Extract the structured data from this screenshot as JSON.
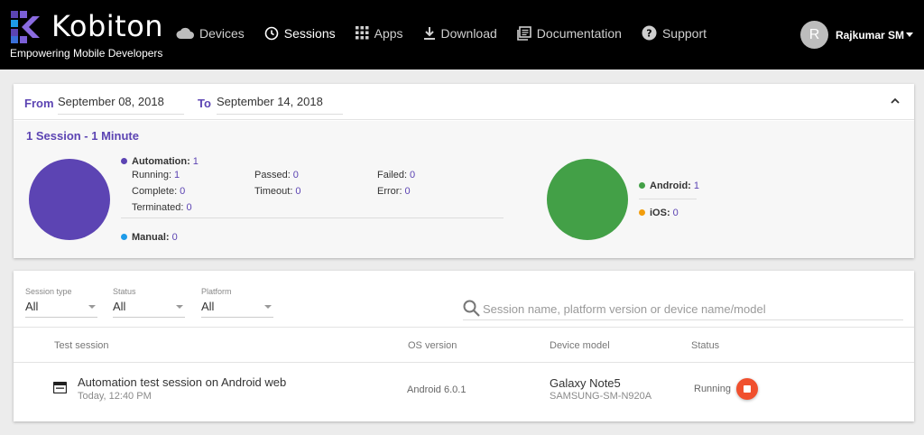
{
  "header": {
    "brand": "Kobiton",
    "tagline": "Empowering Mobile Developers",
    "nav": [
      {
        "label": "Devices",
        "icon": "cloud-icon"
      },
      {
        "label": "Sessions",
        "icon": "clock-icon",
        "active": true
      },
      {
        "label": "Apps",
        "icon": "grid-icon"
      },
      {
        "label": "Download",
        "icon": "download-icon"
      },
      {
        "label": "Documentation",
        "icon": "docs-icon"
      },
      {
        "label": "Support",
        "icon": "help-icon"
      }
    ],
    "user": {
      "initial": "R",
      "name": "Rajkumar SM"
    }
  },
  "summary": {
    "from_label": "From",
    "from_value": "September 08, 2018",
    "to_label": "To",
    "to_value": "September 14, 2018",
    "session_count": "1 Session - 1 Minute",
    "automation": {
      "label": "Automation:",
      "value": "1"
    },
    "stats": [
      {
        "label": "Running:",
        "value": "1"
      },
      {
        "label": "Passed:",
        "value": "0"
      },
      {
        "label": "Failed:",
        "value": "0"
      },
      {
        "label": "Complete:",
        "value": "0"
      },
      {
        "label": "Timeout:",
        "value": "0"
      },
      {
        "label": "Error:",
        "value": "0"
      },
      {
        "label": "Terminated:",
        "value": "0"
      }
    ],
    "manual": {
      "label": "Manual:",
      "value": "0"
    },
    "android": {
      "label": "Android:",
      "value": "1"
    },
    "ios": {
      "label": "iOS:",
      "value": "0"
    }
  },
  "filters": {
    "session_type": {
      "label": "Session type",
      "value": "All"
    },
    "status": {
      "label": "Status",
      "value": "All"
    },
    "platform": {
      "label": "Platform",
      "value": "All"
    },
    "search_placeholder": "Session name, platform version or device name/model"
  },
  "table": {
    "headers": [
      "Test session",
      "OS version",
      "Device model",
      "Status"
    ],
    "rows": [
      {
        "name": "Automation test session on Android web",
        "time": "Today, 12:40 PM",
        "os": "Android 6.0.1",
        "device": "Galaxy Note5",
        "model": "SAMSUNG-SM-N920A",
        "status": "Running"
      }
    ]
  },
  "colors": {
    "automation": "#5c44b3",
    "manual": "#1e9be9",
    "android": "#43a047",
    "ios": "#f29d0c",
    "stop": "#f0502e"
  }
}
